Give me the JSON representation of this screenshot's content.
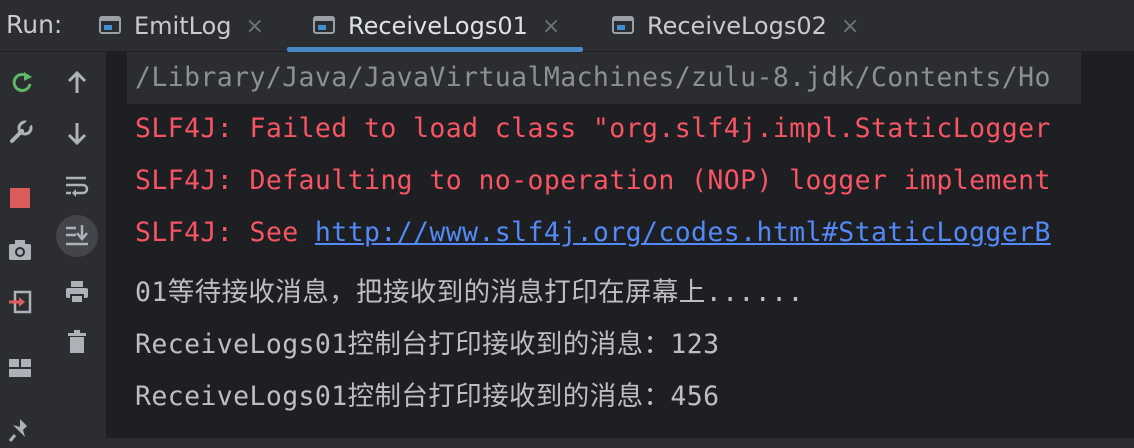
{
  "run": {
    "label": "Run:"
  },
  "tabs": [
    {
      "label": "EmitLog",
      "close": "×",
      "active": false
    },
    {
      "label": "ReceiveLogs01",
      "close": "×",
      "active": true
    },
    {
      "label": "ReceiveLogs02",
      "close": "×",
      "active": false
    }
  ],
  "toolbar_left": [
    {
      "icon": "rerun-icon"
    },
    {
      "icon": "wrench-icon"
    },
    {
      "icon": "stop-icon"
    },
    {
      "icon": "camera-icon"
    },
    {
      "icon": "exit-icon"
    },
    {
      "icon": "layout-icon"
    },
    {
      "icon": "pin-icon"
    }
  ],
  "toolbar_right": [
    {
      "icon": "arrow-up-icon"
    },
    {
      "icon": "arrow-down-icon"
    },
    {
      "icon": "soft-wrap-icon"
    },
    {
      "icon": "scroll-to-end-icon",
      "selected": true
    },
    {
      "icon": "print-icon"
    },
    {
      "icon": "trash-icon"
    }
  ],
  "console": {
    "lines": [
      {
        "text": "/Library/Java/JavaVirtualMachines/zulu-8.jdk/Contents/Ho",
        "kind": "cmd"
      },
      {
        "text": "SLF4J: Failed to load class \"org.slf4j.impl.StaticLogger",
        "kind": "err"
      },
      {
        "text": "SLF4J: Defaulting to no-operation (NOP) logger implement",
        "kind": "err"
      },
      {
        "prefix": "SLF4J: See ",
        "link": "http://www.slf4j.org/codes.html#StaticLoggerB",
        "kind": "err"
      },
      {
        "text": "01等待接收消息，把接收到的消息打印在屏幕上......",
        "kind": "out"
      },
      {
        "text": "ReceiveLogs01控制台打印接收到的消息：123",
        "kind": "out"
      },
      {
        "text": "ReceiveLogs01控制台打印接收到的消息：456",
        "kind": "out"
      }
    ]
  },
  "colors": {
    "error": "#f75464",
    "link": "#548af7",
    "output": "#bcbec4",
    "accent": "#4a88c7",
    "rerun": "#5fb865",
    "stop": "#db5c5c"
  }
}
